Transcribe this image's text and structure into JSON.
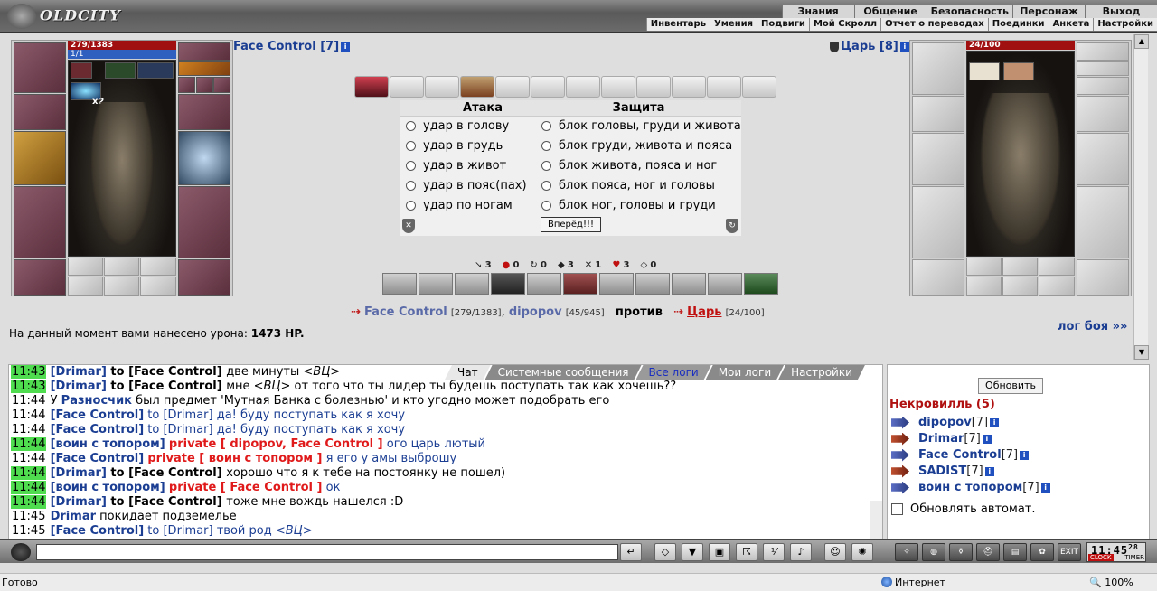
{
  "header": {
    "logo": "OLDCITY",
    "menu_top": [
      "Знания",
      "Общение",
      "Безопасность",
      "Персонаж",
      "Выход"
    ],
    "menu_bottom": [
      "Инвентарь",
      "Умения",
      "Подвиги",
      "Мой Скролл",
      "Отчет о переводах",
      "Поединки",
      "Анкета",
      "Настройки"
    ]
  },
  "player": {
    "name": "Face Control [7]",
    "hp": "279/1383",
    "mp": "1/1",
    "stack": "x2"
  },
  "enemy": {
    "name": "Царь [8]",
    "hp": "24/100"
  },
  "battle": {
    "attack_title": "Атака",
    "defense_title": "Защита",
    "attack_options": [
      "удар в голову",
      "удар в грудь",
      "удар в живот",
      "удар в пояс(пах)",
      "удар по ногам"
    ],
    "defense_options": [
      "блок головы, груди и живота",
      "блок груди, живота и пояса",
      "блок живота, пояса и ног",
      "блок пояса, ног и головы",
      "блок ног, головы и груди"
    ],
    "go_button": "Вперёд!!!",
    "stats": [
      "3",
      "0",
      "0",
      "3",
      "1",
      "3",
      "0"
    ],
    "vs_player1": "Face Control",
    "vs_player1_hp": "[279/1383]",
    "vs_player2": "dipopov",
    "vs_player2_hp": "[45/945]",
    "vs_word": "против",
    "vs_enemy": "Царь",
    "vs_enemy_hp": "[24/100]",
    "damage_prefix": "На данный момент вами нанесено урона:",
    "damage_value": "1473 HP.",
    "log_link": "лог боя »»"
  },
  "chat": {
    "tabs": [
      "Чат",
      "Системные сообщения",
      "Все логи",
      "Мои логи",
      "Настройки"
    ],
    "messages": [
      {
        "time": "11:43",
        "hl": true,
        "pre": "",
        "name": "[Drimar]",
        "mid": " to [Face Control] ",
        "mid_cls": "sys",
        "priv": "",
        "text": "две минуты ",
        "em": "<ВЦ>"
      },
      {
        "time": "11:43",
        "hl": true,
        "pre": "",
        "name": "[Drimar]",
        "mid": " to [Face Control] ",
        "mid_cls": "sys",
        "priv": "",
        "text": "мне ",
        "em": "<ВЦ>",
        "text2": " от того что ты лидер ты будешь поступать так как хочешь??"
      },
      {
        "time": "11:44",
        "hl": false,
        "pre": "У ",
        "name": "Разносчик",
        "mid": " был предмет 'Мутная Банка с болезнью' и кто угодно может подобрать его",
        "mid_cls": "text",
        "priv": "",
        "text": "",
        "em": ""
      },
      {
        "time": "11:44",
        "hl": false,
        "pre": "",
        "name": "[Face Control]",
        "mid": " to [Drimar] ",
        "mid_cls": "tw",
        "priv": "",
        "text": "да! буду поступать как я хочу",
        "text_cls": "tw",
        "em": ""
      },
      {
        "time": "11:44",
        "hl": false,
        "pre": "",
        "name": "[Face Control]",
        "mid": " to [Drimar] ",
        "mid_cls": "tw",
        "priv": "",
        "text": "да! буду поступать как я хочу",
        "text_cls": "tw",
        "em": ""
      },
      {
        "time": "11:44",
        "hl": true,
        "pre": "",
        "name": "[воин с топором]",
        "mid": " ",
        "mid_cls": "text",
        "priv": "private [ dipopov, Face Control ]",
        "text": " ого царь лютый",
        "text_cls": "tw",
        "em": ""
      },
      {
        "time": "11:44",
        "hl": false,
        "pre": "",
        "name": "[Face Control]",
        "mid": " ",
        "mid_cls": "text",
        "priv": "private [ воин с топором ]",
        "text": " я его у амы выброшу",
        "text_cls": "tw",
        "em": ""
      },
      {
        "time": "11:44",
        "hl": true,
        "pre": "",
        "name": "[Drimar]",
        "mid": " to [Face Control] ",
        "mid_cls": "sys",
        "priv": "",
        "text": "хорошо что я к тебе на постоянку не пошел)",
        "em": ""
      },
      {
        "time": "11:44",
        "hl": true,
        "pre": "",
        "name": "[воин с топором]",
        "mid": " ",
        "mid_cls": "text",
        "priv": "private [ Face Control ]",
        "text": " ок",
        "text_cls": "tw",
        "em": ""
      },
      {
        "time": "11:44",
        "hl": true,
        "pre": "",
        "name": "[Drimar]",
        "mid": " to [Face Control] ",
        "mid_cls": "sys",
        "priv": "",
        "text": "тоже мне вождь нашелся :D",
        "em": ""
      },
      {
        "time": "11:45",
        "hl": false,
        "pre": "",
        "name": "Drimar",
        "mid": " покидает подземелье",
        "mid_cls": "text",
        "priv": "",
        "text": "",
        "em": ""
      },
      {
        "time": "11:45",
        "hl": false,
        "pre": "",
        "name": "[Face Control]",
        "mid": " to [Drimar] ",
        "mid_cls": "tw",
        "priv": "",
        "text": "твой род ",
        "text_cls": "tw",
        "em": "<ВЦ>"
      }
    ]
  },
  "users": {
    "refresh": "Обновить",
    "room": "Некровилль (5)",
    "list": [
      {
        "name": "dipopov",
        "lv": "[7]",
        "red": false
      },
      {
        "name": "Drimar",
        "lv": "[7]",
        "red": true
      },
      {
        "name": "Face Control",
        "lv": "[7]",
        "red": false
      },
      {
        "name": "SADIST",
        "lv": "[7]",
        "red": true
      },
      {
        "name": "воин с топором",
        "lv": "[7]",
        "red": false
      }
    ],
    "auto": "Обновлять автомат."
  },
  "clock": {
    "time": "11:45",
    "sec": "28",
    "clock_label": "CLOCK",
    "timer_label": "TIMER",
    "exit": "EXIT"
  },
  "statusbar": {
    "ready": "Готово",
    "zone": "Интернет",
    "zoom": "100%"
  }
}
